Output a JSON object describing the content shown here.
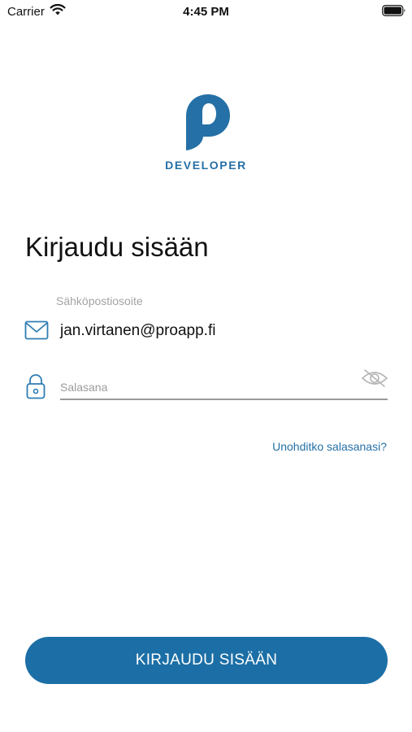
{
  "status_bar": {
    "carrier": "Carrier",
    "time": "4:45 PM",
    "wifi_icon": "wifi-icon",
    "battery_icon": "battery-icon"
  },
  "brand": {
    "logo_icon": "p-logo-icon",
    "name": "DEVELOPER",
    "color": "#2570a6"
  },
  "login": {
    "title": "Kirjaudu sisään",
    "email": {
      "label": "Sähköpostiosoite",
      "value": "jan.virtanen@proapp.fi",
      "icon": "mail-icon"
    },
    "password": {
      "placeholder": "Salasana",
      "value": "",
      "icon": "lock-icon",
      "toggle_icon": "eye-off-icon"
    },
    "forgot_link": "Unohditko salasanasi?",
    "submit_label": "KIRJAUDU SISÄÄN",
    "button_color": "#1c6fa6"
  }
}
